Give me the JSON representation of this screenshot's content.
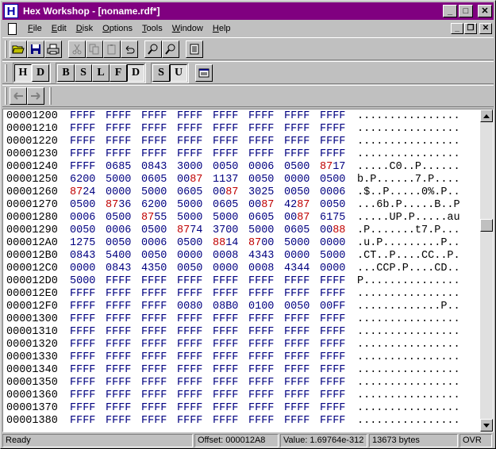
{
  "window": {
    "title": "Hex Workshop - [noname.rdf*]",
    "app_icon_letter": "H"
  },
  "title_buttons": {
    "minimize": "_",
    "maximize": "□",
    "close": "✕"
  },
  "menu": {
    "items": [
      {
        "pre": "",
        "key": "F",
        "post": "ile"
      },
      {
        "pre": "",
        "key": "E",
        "post": "dit"
      },
      {
        "pre": "",
        "key": "D",
        "post": "isk"
      },
      {
        "pre": "",
        "key": "O",
        "post": "ptions"
      },
      {
        "pre": "",
        "key": "T",
        "post": "ools"
      },
      {
        "pre": "",
        "key": "W",
        "post": "indow"
      },
      {
        "pre": "",
        "key": "H",
        "post": "elp"
      }
    ]
  },
  "mdi_buttons": {
    "minimize": "_",
    "restore": "❐",
    "close": "✕"
  },
  "toolbar2": {
    "mode_a": [
      "H",
      "D"
    ],
    "mode_b": [
      "B",
      "S",
      "L",
      "F",
      "D"
    ],
    "mode_c": [
      "S",
      "U"
    ]
  },
  "hex": {
    "rows": [
      {
        "addr": "00001200",
        "words": [
          "FFFF",
          "FFFF",
          "FFFF",
          "FFFF",
          "FFFF",
          "FFFF",
          "FFFF",
          "FFFF"
        ],
        "ascii": "................"
      },
      {
        "addr": "00001210",
        "words": [
          "FFFF",
          "FFFF",
          "FFFF",
          "FFFF",
          "FFFF",
          "FFFF",
          "FFFF",
          "FFFF"
        ],
        "ascii": "................"
      },
      {
        "addr": "00001220",
        "words": [
          "FFFF",
          "FFFF",
          "FFFF",
          "FFFF",
          "FFFF",
          "FFFF",
          "FFFF",
          "FFFF"
        ],
        "ascii": "................"
      },
      {
        "addr": "00001230",
        "words": [
          "FFFF",
          "FFFF",
          "FFFF",
          "FFFF",
          "FFFF",
          "FFFF",
          "FFFF",
          "FFFF"
        ],
        "ascii": "................"
      },
      {
        "addr": "00001240",
        "words": [
          "FFFF",
          "0685",
          "0843",
          "3000",
          "0050",
          "0006",
          "0500",
          "8717"
        ],
        "ascii": ".....C0..P......"
      },
      {
        "addr": "00001250",
        "words": [
          "6200",
          "5000",
          "0605",
          "0087",
          "1137",
          "0050",
          "0000",
          "0500"
        ],
        "ascii": "b.P......7.P...."
      },
      {
        "addr": "00001260",
        "words": [
          "8724",
          "0000",
          "5000",
          "0605",
          "0087",
          "3025",
          "0050",
          "0006"
        ],
        "ascii": ".$..P.....0%.P.."
      },
      {
        "addr": "00001270",
        "words": [
          "0500",
          "8736",
          "6200",
          "5000",
          "0605",
          "0087",
          "4287",
          "0050"
        ],
        "ascii": "...6b.P.....B..P"
      },
      {
        "addr": "00001280",
        "words": [
          "0006",
          "0500",
          "8755",
          "5000",
          "5000",
          "0605",
          "0087",
          "6175"
        ],
        "ascii": ".....UP.P.....au"
      },
      {
        "addr": "00001290",
        "words": [
          "0050",
          "0006",
          "0500",
          "8774",
          "3700",
          "5000",
          "0605",
          "0088"
        ],
        "ascii": ".P.......t7.P..."
      },
      {
        "addr": "000012A0",
        "words": [
          "1275",
          "0050",
          "0006",
          "0500",
          "8814",
          "8700",
          "5000",
          "0000"
        ],
        "ascii": ".u.P.........P.."
      },
      {
        "addr": "000012B0",
        "words": [
          "0843",
          "5400",
          "0050",
          "0000",
          "0008",
          "4343",
          "0000",
          "5000"
        ],
        "ascii": ".CT..P....CC..P."
      },
      {
        "addr": "000012C0",
        "words": [
          "0000",
          "0843",
          "4350",
          "0050",
          "0000",
          "0008",
          "4344",
          "0000"
        ],
        "ascii": "...CCP.P....CD.."
      },
      {
        "addr": "000012D0",
        "words": [
          "5000",
          "FFFF",
          "FFFF",
          "FFFF",
          "FFFF",
          "FFFF",
          "FFFF",
          "FFFF"
        ],
        "ascii": "P..............."
      },
      {
        "addr": "000012E0",
        "words": [
          "FFFF",
          "FFFF",
          "FFFF",
          "FFFF",
          "FFFF",
          "FFFF",
          "FFFF",
          "FFFF"
        ],
        "ascii": "................"
      },
      {
        "addr": "000012F0",
        "words": [
          "FFFF",
          "FFFF",
          "FFFF",
          "0080",
          "08B0",
          "0100",
          "0050",
          "00FF"
        ],
        "ascii": ".............P.."
      },
      {
        "addr": "00001300",
        "words": [
          "FFFF",
          "FFFF",
          "FFFF",
          "FFFF",
          "FFFF",
          "FFFF",
          "FFFF",
          "FFFF"
        ],
        "ascii": "................"
      },
      {
        "addr": "00001310",
        "words": [
          "FFFF",
          "FFFF",
          "FFFF",
          "FFFF",
          "FFFF",
          "FFFF",
          "FFFF",
          "FFFF"
        ],
        "ascii": "................"
      },
      {
        "addr": "00001320",
        "words": [
          "FFFF",
          "FFFF",
          "FFFF",
          "FFFF",
          "FFFF",
          "FFFF",
          "FFFF",
          "FFFF"
        ],
        "ascii": "................"
      },
      {
        "addr": "00001330",
        "words": [
          "FFFF",
          "FFFF",
          "FFFF",
          "FFFF",
          "FFFF",
          "FFFF",
          "FFFF",
          "FFFF"
        ],
        "ascii": "................"
      },
      {
        "addr": "00001340",
        "words": [
          "FFFF",
          "FFFF",
          "FFFF",
          "FFFF",
          "FFFF",
          "FFFF",
          "FFFF",
          "FFFF"
        ],
        "ascii": "................"
      },
      {
        "addr": "00001350",
        "words": [
          "FFFF",
          "FFFF",
          "FFFF",
          "FFFF",
          "FFFF",
          "FFFF",
          "FFFF",
          "FFFF"
        ],
        "ascii": "................"
      },
      {
        "addr": "00001360",
        "words": [
          "FFFF",
          "FFFF",
          "FFFF",
          "FFFF",
          "FFFF",
          "FFFF",
          "FFFF",
          "FFFF"
        ],
        "ascii": "................"
      },
      {
        "addr": "00001370",
        "words": [
          "FFFF",
          "FFFF",
          "FFFF",
          "FFFF",
          "FFFF",
          "FFFF",
          "FFFF",
          "FFFF"
        ],
        "ascii": "................"
      },
      {
        "addr": "00001380",
        "words": [
          "FFFF",
          "FFFF",
          "FFFF",
          "FFFF",
          "FFFF",
          "FFFF",
          "FFFF",
          "FFFF"
        ],
        "ascii": "................"
      }
    ],
    "modified_color": "#c00000",
    "normal_color": "#000080"
  },
  "status": {
    "ready": "Ready",
    "offset": "Offset: 000012A8",
    "value": "Value: 1.69764e-312",
    "size": "13673 bytes",
    "mode": "OVR"
  }
}
